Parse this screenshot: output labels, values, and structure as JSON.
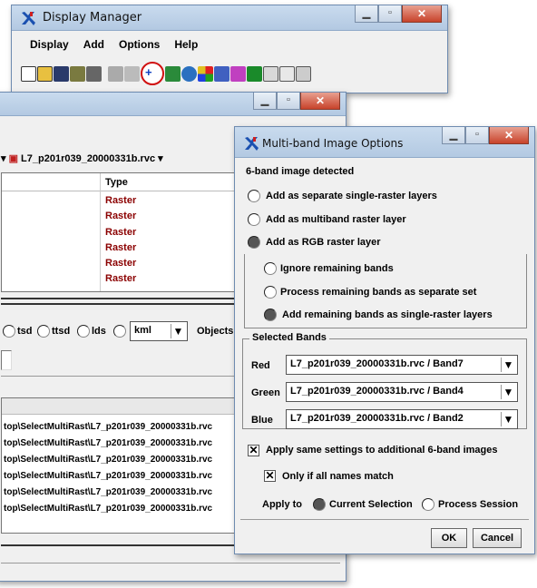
{
  "display_manager": {
    "title": "Display Manager",
    "menu": [
      "Display",
      "Add",
      "Options",
      "Help"
    ],
    "toolbar_icons": [
      "new-doc-icon",
      "open-folder-icon",
      "save-icon",
      "print-setup-icon",
      "print-icon",
      "disabled-icon",
      "disabled-icon",
      "add-layer-icon",
      "add-raster-icon",
      "globe-icon",
      "color-grid-icon",
      "shapes-icon",
      "grid-icon",
      "tree-icon",
      "scale-icon",
      "doc-icon",
      "table-icon"
    ]
  },
  "layer_window": {
    "file_label": "L7_p201r039_20000331b.rvc",
    "type_header": "Type",
    "types": [
      "Raster",
      "Raster",
      "Raster",
      "Raster",
      "Raster",
      "Raster"
    ],
    "formats": [
      "tsd",
      "ttsd",
      "lds",
      "kml"
    ],
    "objects_label": "Objects",
    "paths": [
      "top\\SelectMultiRast\\L7_p201r039_20000331b.rvc",
      "top\\SelectMultiRast\\L7_p201r039_20000331b.rvc",
      "top\\SelectMultiRast\\L7_p201r039_20000331b.rvc",
      "top\\SelectMultiRast\\L7_p201r039_20000331b.rvc",
      "top\\SelectMultiRast\\L7_p201r039_20000331b.rvc",
      "top\\SelectMultiRast\\L7_p201r039_20000331b.rvc"
    ]
  },
  "dialog": {
    "title": "Multi-band Image Options",
    "detected": "6-band image detected",
    "opt_separate": "Add as separate single-raster layers",
    "opt_multiband": "Add as multiband raster layer",
    "opt_rgb": "Add as RGB raster layer",
    "sub_ignore": "Ignore remaining bands",
    "sub_process": "Process remaining bands as separate set",
    "sub_add": "Add remaining bands as single-raster layers",
    "selected_bands": "Selected Bands",
    "bands": [
      {
        "label": "Red",
        "value": "L7_p201r039_20000331b.rvc / Band7"
      },
      {
        "label": "Green",
        "value": "L7_p201r039_20000331b.rvc / Band4"
      },
      {
        "label": "Blue",
        "value": "L7_p201r039_20000331b.rvc / Band2"
      }
    ],
    "apply_same": "Apply same settings to additional 6-band images",
    "only_if": "Only if all names match",
    "apply_to": "Apply to",
    "current_selection": "Current Selection",
    "process_session": "Process Session",
    "ok": "OK",
    "cancel": "Cancel"
  }
}
